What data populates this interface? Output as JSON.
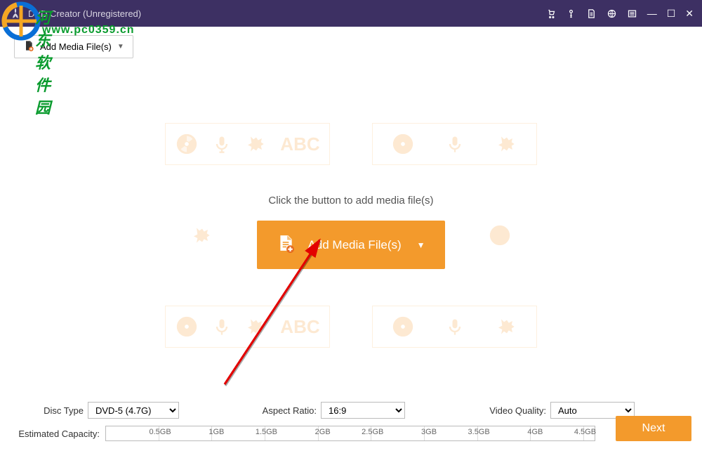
{
  "titlebar": {
    "title": "DVD Creator (Unregistered)"
  },
  "toolbar": {
    "add_small_label": "Add Media File(s)"
  },
  "main": {
    "hint": "Click the button to add media file(s)",
    "add_large_label": "Add Media File(s)",
    "placeholder_text": "ABC"
  },
  "bottom": {
    "disc_type_label": "Disc Type",
    "disc_type_value": "DVD-5 (4.7G)",
    "aspect_ratio_label": "Aspect Ratio:",
    "aspect_ratio_value": "16:9",
    "video_quality_label": "Video Quality:",
    "video_quality_value": "Auto",
    "estimated_capacity_label": "Estimated Capacity:",
    "ticks": [
      "0.5GB",
      "1GB",
      "1.5GB",
      "2GB",
      "2.5GB",
      "3GB",
      "3.5GB",
      "4GB",
      "4.5GB"
    ],
    "next_label": "Next"
  },
  "watermark": {
    "line1": "河东软件园",
    "line2": "www.pc0359.cn"
  }
}
